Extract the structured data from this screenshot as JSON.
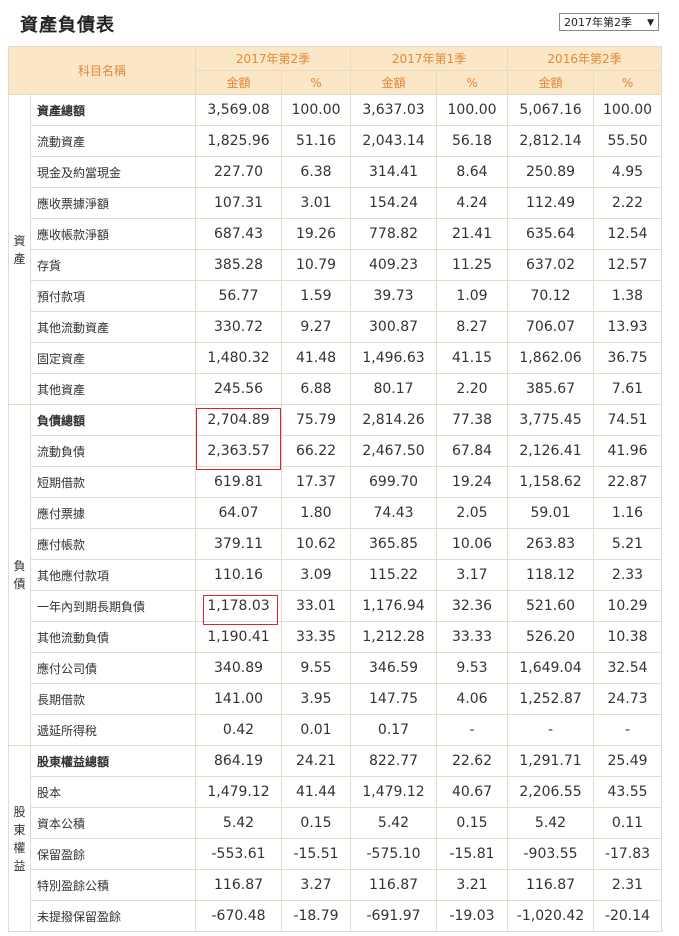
{
  "page_title": "資產負債表",
  "period_select": {
    "value": "2017年第2季"
  },
  "header": {
    "item_label": "科目名稱",
    "periods": [
      "2017年第2季",
      "2017年第1季",
      "2016年第2季"
    ],
    "amount_label": "金額",
    "percent_label": "%"
  },
  "groups": [
    {
      "label": "資\n產",
      "rows": [
        {
          "name": "資產總額",
          "bold": true,
          "v": [
            "3,569.08",
            "100.00",
            "3,637.03",
            "100.00",
            "5,067.16",
            "100.00"
          ]
        },
        {
          "name": "流動資產",
          "bold": false,
          "v": [
            "1,825.96",
            "51.16",
            "2,043.14",
            "56.18",
            "2,812.14",
            "55.50"
          ]
        },
        {
          "name": "現金及約當現金",
          "bold": false,
          "v": [
            "227.70",
            "6.38",
            "314.41",
            "8.64",
            "250.89",
            "4.95"
          ]
        },
        {
          "name": "應收票據淨額",
          "bold": false,
          "v": [
            "107.31",
            "3.01",
            "154.24",
            "4.24",
            "112.49",
            "2.22"
          ]
        },
        {
          "name": "應收帳款淨額",
          "bold": false,
          "v": [
            "687.43",
            "19.26",
            "778.82",
            "21.41",
            "635.64",
            "12.54"
          ]
        },
        {
          "name": "存貨",
          "bold": false,
          "v": [
            "385.28",
            "10.79",
            "409.23",
            "11.25",
            "637.02",
            "12.57"
          ]
        },
        {
          "name": "預付款項",
          "bold": false,
          "v": [
            "56.77",
            "1.59",
            "39.73",
            "1.09",
            "70.12",
            "1.38"
          ]
        },
        {
          "name": "其他流動資產",
          "bold": false,
          "v": [
            "330.72",
            "9.27",
            "300.87",
            "8.27",
            "706.07",
            "13.93"
          ]
        },
        {
          "name": "固定資產",
          "bold": false,
          "v": [
            "1,480.32",
            "41.48",
            "1,496.63",
            "41.15",
            "1,862.06",
            "36.75"
          ]
        },
        {
          "name": "其他資產",
          "bold": false,
          "v": [
            "245.56",
            "6.88",
            "80.17",
            "2.20",
            "385.67",
            "7.61"
          ]
        }
      ]
    },
    {
      "label": "負\n債",
      "rows": [
        {
          "name": "負債總額",
          "bold": true,
          "v": [
            "2,704.89",
            "75.79",
            "2,814.26",
            "77.38",
            "3,775.45",
            "74.51"
          ]
        },
        {
          "name": "流動負債",
          "bold": false,
          "v": [
            "2,363.57",
            "66.22",
            "2,467.50",
            "67.84",
            "2,126.41",
            "41.96"
          ]
        },
        {
          "name": "短期借款",
          "bold": false,
          "v": [
            "619.81",
            "17.37",
            "699.70",
            "19.24",
            "1,158.62",
            "22.87"
          ]
        },
        {
          "name": "應付票據",
          "bold": false,
          "v": [
            "64.07",
            "1.80",
            "74.43",
            "2.05",
            "59.01",
            "1.16"
          ]
        },
        {
          "name": "應付帳款",
          "bold": false,
          "v": [
            "379.11",
            "10.62",
            "365.85",
            "10.06",
            "263.83",
            "5.21"
          ]
        },
        {
          "name": "其他應付款項",
          "bold": false,
          "v": [
            "110.16",
            "3.09",
            "115.22",
            "3.17",
            "118.12",
            "2.33"
          ]
        },
        {
          "name": "一年內到期長期負債",
          "bold": false,
          "v": [
            "1,178.03",
            "33.01",
            "1,176.94",
            "32.36",
            "521.60",
            "10.29"
          ]
        },
        {
          "name": "其他流動負債",
          "bold": false,
          "v": [
            "1,190.41",
            "33.35",
            "1,212.28",
            "33.33",
            "526.20",
            "10.38"
          ]
        },
        {
          "name": "應付公司債",
          "bold": false,
          "v": [
            "340.89",
            "9.55",
            "346.59",
            "9.53",
            "1,649.04",
            "32.54"
          ]
        },
        {
          "name": "長期借款",
          "bold": false,
          "v": [
            "141.00",
            "3.95",
            "147.75",
            "4.06",
            "1,252.87",
            "24.73"
          ]
        },
        {
          "name": "遞延所得稅",
          "bold": false,
          "v": [
            "0.42",
            "0.01",
            "0.17",
            "-",
            "-",
            "-"
          ]
        }
      ]
    },
    {
      "label": "股\n東\n權\n益",
      "rows": [
        {
          "name": "股東權益總額",
          "bold": true,
          "v": [
            "864.19",
            "24.21",
            "822.77",
            "22.62",
            "1,291.71",
            "25.49"
          ]
        },
        {
          "name": "股本",
          "bold": false,
          "v": [
            "1,479.12",
            "41.44",
            "1,479.12",
            "40.67",
            "2,206.55",
            "43.55"
          ]
        },
        {
          "name": "資本公積",
          "bold": false,
          "v": [
            "5.42",
            "0.15",
            "5.42",
            "0.15",
            "5.42",
            "0.11"
          ]
        },
        {
          "name": "保留盈餘",
          "bold": false,
          "v": [
            "-553.61",
            "-15.51",
            "-575.10",
            "-15.81",
            "-903.55",
            "-17.83"
          ]
        },
        {
          "name": "特別盈餘公積",
          "bold": false,
          "v": [
            "116.87",
            "3.27",
            "116.87",
            "3.21",
            "116.87",
            "2.31"
          ]
        },
        {
          "name": "未提撥保留盈餘",
          "bold": false,
          "v": [
            "-670.48",
            "-18.79",
            "-691.97",
            "-19.03",
            "-1,020.42",
            "-20.14"
          ]
        }
      ]
    }
  ]
}
